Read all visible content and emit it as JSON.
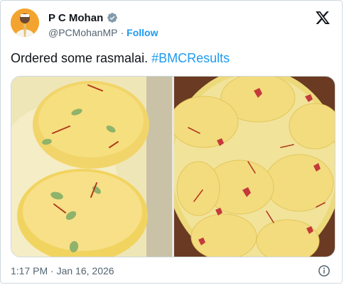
{
  "author": {
    "display_name": "P C Mohan",
    "handle": "@PCMohanMP",
    "separator": "·",
    "follow_label": "Follow"
  },
  "tweet": {
    "text": "Ordered some rasmalai.",
    "hashtag": "#BMCResults"
  },
  "footer": {
    "time": "1:17 PM",
    "separator": "·",
    "date": "Jan 16, 2026"
  },
  "colors": {
    "accent": "#1d9bf0",
    "verified_badge": "#829aab"
  },
  "icons": {
    "verified": "verified-badge-icon",
    "x_logo": "x-logo-icon",
    "info": "info-icon"
  }
}
